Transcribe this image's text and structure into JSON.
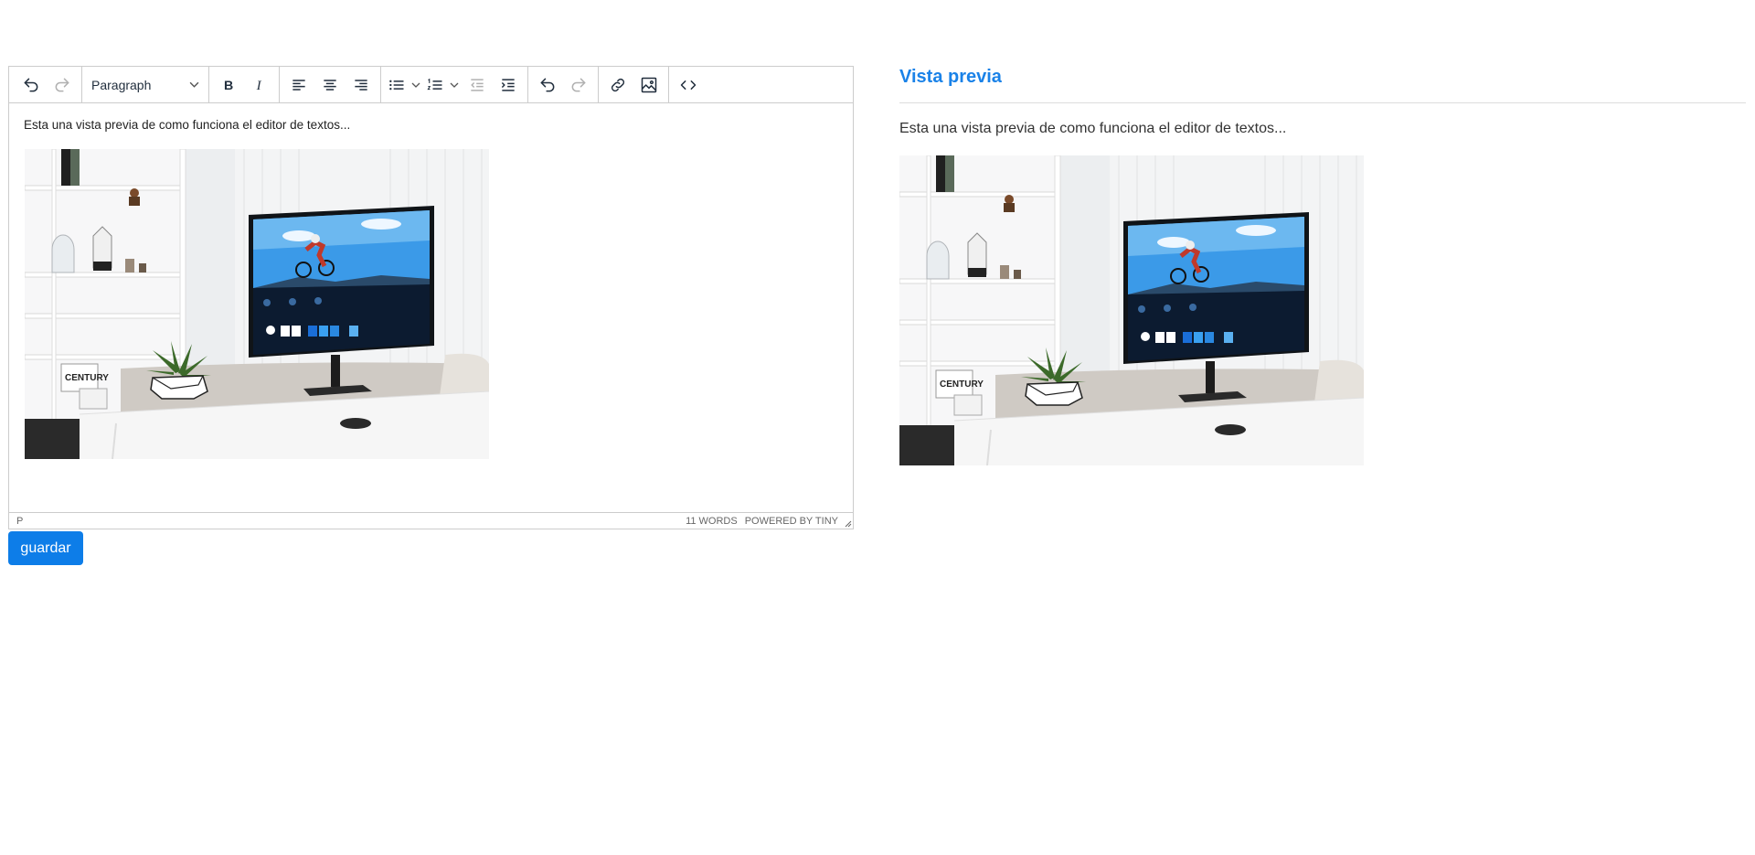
{
  "editor": {
    "toolbar": {
      "format_select": "Paragraph",
      "icons": [
        "undo-icon",
        "redo-icon",
        "bold-icon",
        "italic-icon",
        "align-left-icon",
        "align-center-icon",
        "align-right-icon",
        "bullet-list-icon",
        "numbered-list-icon",
        "outdent-icon",
        "indent-icon",
        "link-icon",
        "image-icon",
        "code-icon"
      ]
    },
    "content_text": "Esta una vista previa de como funciona el editor de textos...",
    "status_path": "P",
    "word_count": "11 WORDS",
    "branding": "POWERED BY TINY"
  },
  "save_button": "guardar",
  "preview": {
    "title": "Vista previa",
    "text": "Esta una vista previa de como funciona el editor de textos..."
  },
  "image": {
    "brand_text": "CENTURY"
  },
  "colors": {
    "accent": "#0d7de8",
    "preview_title": "#1a82e8",
    "border": "#cccccc"
  }
}
